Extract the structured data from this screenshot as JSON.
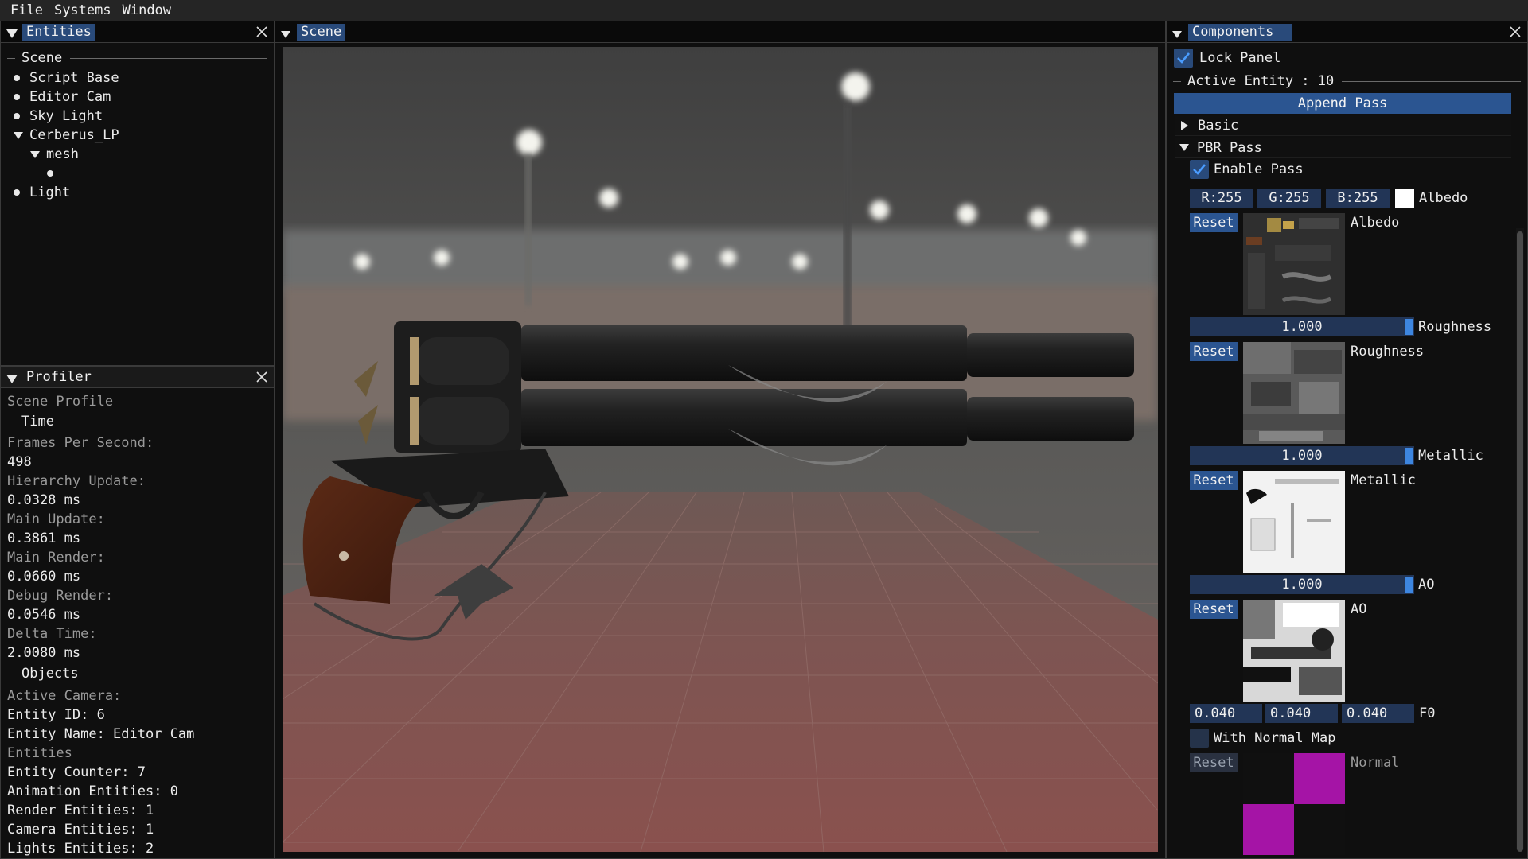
{
  "menu": {
    "items": [
      "File",
      "Systems",
      "Window"
    ]
  },
  "entities_panel": {
    "title": "Entities",
    "section": "Scene",
    "items": [
      {
        "label": "Script Base",
        "icon": "bullet"
      },
      {
        "label": "Editor Cam",
        "icon": "bullet"
      },
      {
        "label": "Sky Light",
        "icon": "bullet"
      },
      {
        "label": "Cerberus_LP",
        "icon": "expanded-triangle"
      },
      {
        "label": "mesh",
        "icon": "expanded-triangle"
      },
      {
        "label": "",
        "icon": "bullet"
      },
      {
        "label": "Light",
        "icon": "bullet"
      }
    ]
  },
  "profiler": {
    "title": "Profiler",
    "heading": "Scene Profile",
    "time_section": "Time",
    "fps_label": "Frames Per Second:",
    "fps_value": "498",
    "hierarchy_label": "Hierarchy Update:",
    "hierarchy_value": "0.0328 ms",
    "main_update_label": "Main Update:",
    "main_update_value": "0.3861 ms",
    "main_render_label": "Main Render:",
    "main_render_value": "0.0660 ms",
    "debug_render_label": "Debug Render:",
    "debug_render_value": "0.0546 ms",
    "delta_label": "Delta Time:",
    "delta_value": "2.0080 ms",
    "objects_section": "Objects",
    "active_camera_label": "Active Camera:",
    "entity_id": "Entity ID: 6",
    "entity_name": "Entity Name: Editor Cam",
    "entities_label": "Entities",
    "entity_counter": "Entity Counter: 7",
    "animation_entities": "Animation Entities: 0",
    "render_entities": "Render Entities: 1",
    "camera_entities": "Camera Entities: 1",
    "lights_entities": "Lights Entities: 2"
  },
  "scene_panel": {
    "title": "Scene"
  },
  "components": {
    "title": "Components",
    "lock_panel": {
      "label": "Lock Panel",
      "checked": true
    },
    "active_entity": "Active Entity : 10",
    "append_pass": "Append Pass",
    "basic_header": "Basic",
    "pbr_header": "PBR Pass",
    "enable_pass": {
      "label": "Enable Pass",
      "checked": true
    },
    "color": {
      "r": "R:255",
      "g": "G:255",
      "b": "B:255",
      "label": "Albedo",
      "swatch": "#ffffff"
    },
    "reset_label": "Reset",
    "albedo_label": "Albedo",
    "roughness": {
      "value": "1.000",
      "label": "Roughness",
      "fill": 1.0
    },
    "roughness_tex_label": "Roughness",
    "metallic": {
      "value": "1.000",
      "label": "Metallic",
      "fill": 1.0
    },
    "metallic_tex_label": "Metallic",
    "ao": {
      "value": "1.000",
      "label": "AO",
      "fill": 1.0
    },
    "ao_tex_label": "AO",
    "f0": {
      "x": "0.040",
      "y": "0.040",
      "z": "0.040",
      "label": "F0"
    },
    "normal_map": {
      "label": "With Normal Map",
      "checked": false
    },
    "normal_label": "Normal",
    "normal_colors": [
      "#101010",
      "#a514a6"
    ]
  },
  "colors": {
    "accent": "#294a7a",
    "button": "#2b5591",
    "field": "#223556",
    "grab": "#3d86e0"
  }
}
